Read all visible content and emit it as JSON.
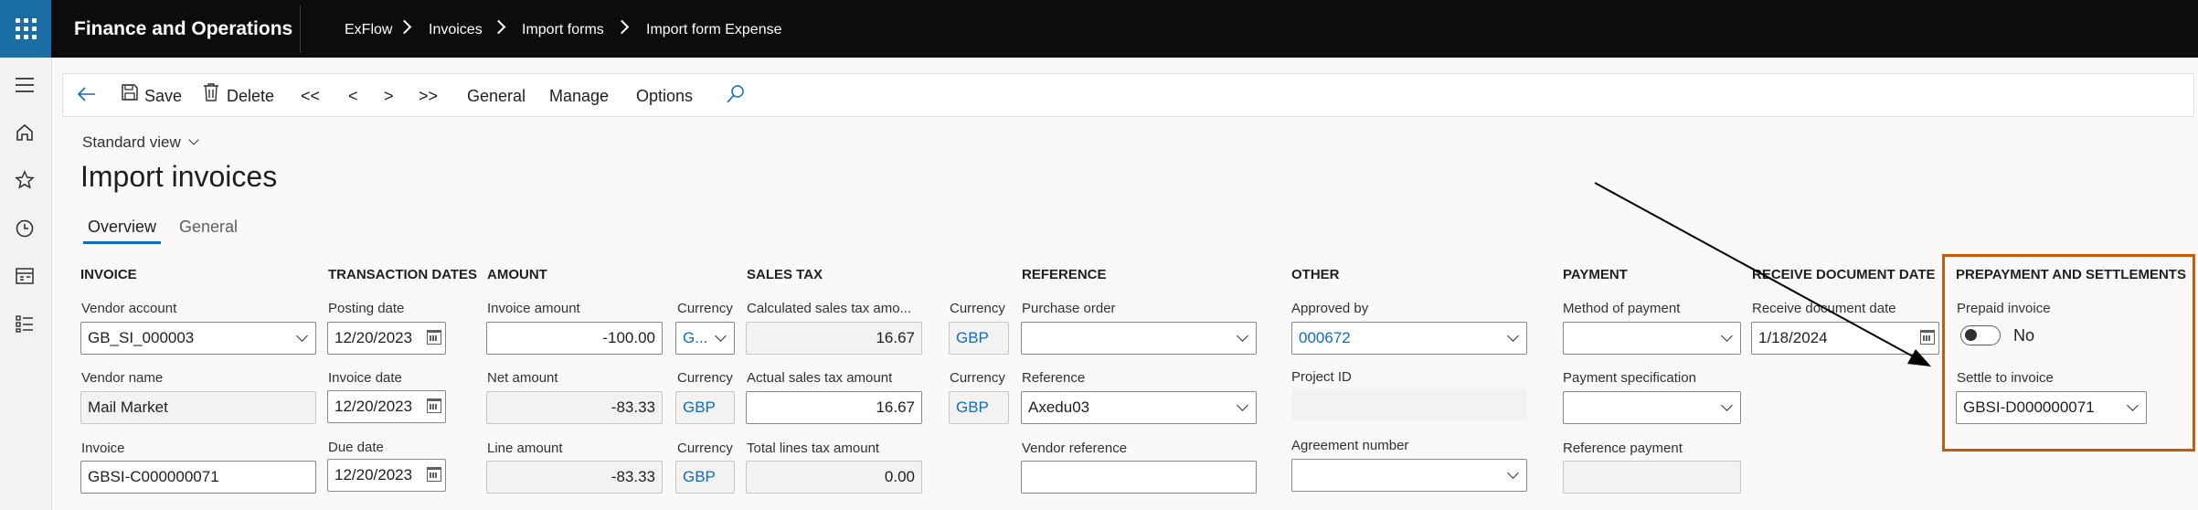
{
  "topbar": {
    "app_title": "Finance and Operations",
    "breadcrumb": [
      "ExFlow",
      "Invoices",
      "Import forms",
      "Import form Expense"
    ]
  },
  "nav": {
    "icons": [
      "hamburger-icon",
      "home-icon",
      "star-icon",
      "clock-icon",
      "workspace-icon",
      "list-icon"
    ]
  },
  "toolbar": {
    "save_label": "Save",
    "delete_label": "Delete",
    "first_label": "<<",
    "prev_label": "<",
    "next_label": ">",
    "last_label": ">>",
    "general_label": "General",
    "manage_label": "Manage",
    "options_label": "Options"
  },
  "page": {
    "view_label": "Standard view",
    "title": "Import invoices",
    "tabs": [
      "Overview",
      "General"
    ]
  },
  "invoice": {
    "title": "INVOICE",
    "vendor_account_label": "Vendor account",
    "vendor_account": "GB_SI_000003",
    "vendor_name_label": "Vendor name",
    "vendor_name": "Mail Market",
    "invoice_label": "Invoice",
    "invoice": "GBSI-C000000071"
  },
  "transaction_dates": {
    "title": "TRANSACTION DATES",
    "posting_date_label": "Posting date",
    "posting_date": "12/20/2023",
    "invoice_date_label": "Invoice date",
    "invoice_date": "12/20/2023",
    "due_date_label": "Due date",
    "due_date": "12/20/2023"
  },
  "amount": {
    "title": "AMOUNT",
    "invoice_amount_label": "Invoice amount",
    "invoice_amount": "-100.00",
    "net_amount_label": "Net amount",
    "net_amount": "-83.33",
    "line_amount_label": "Line amount",
    "line_amount": "-83.33",
    "currency_label": "Currency",
    "currency_1": "G...",
    "currency_2": "GBP",
    "currency_3": "GBP"
  },
  "sales_tax": {
    "title": "SALES TAX",
    "calculated_label": "Calculated sales tax amo...",
    "calculated": "16.67",
    "actual_label": "Actual sales tax amount",
    "actual": "16.67",
    "total_lines_label": "Total lines tax amount",
    "total_lines": "0.00",
    "currency_label": "Currency",
    "currency_1": "GBP",
    "currency_2": "GBP"
  },
  "reference": {
    "title": "REFERENCE",
    "purchase_order_label": "Purchase order",
    "purchase_order": "",
    "reference_label": "Reference",
    "reference": "Axedu03",
    "vendor_reference_label": "Vendor reference",
    "vendor_reference": ""
  },
  "other": {
    "title": "OTHER",
    "approved_by_label": "Approved by",
    "approved_by": "000672",
    "project_id_label": "Project ID",
    "project_id": "",
    "agreement_number_label": "Agreement number",
    "agreement_number": ""
  },
  "payment": {
    "title": "PAYMENT",
    "method_label": "Method of payment",
    "method": "",
    "specification_label": "Payment specification",
    "specification": "",
    "reference_payment_label": "Reference payment",
    "reference_payment": ""
  },
  "receive_document_date": {
    "title": "RECEIVE DOCUMENT DATE",
    "label": "Receive document date",
    "value": "1/18/2024"
  },
  "prepayment": {
    "title": "PREPAYMENT AND SETTLEMENTS",
    "prepaid_label": "Prepaid invoice",
    "prepaid_value": "No",
    "settle_label": "Settle to invoice",
    "settle_value": "GBSI-D000000071"
  },
  "colors": {
    "topbar": "#0c0c0c",
    "waffle": "#1b6ea3",
    "highlight_border": "#c55a11",
    "link": "#0f6cbd"
  }
}
